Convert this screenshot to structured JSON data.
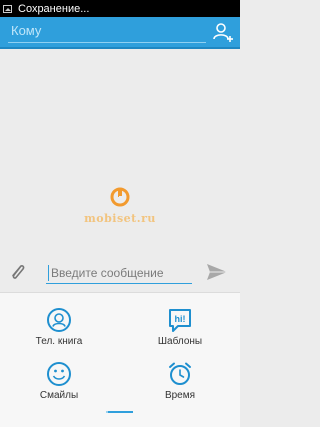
{
  "status_bar": {
    "text": "Сохранение..."
  },
  "header": {
    "to_placeholder": "Кому"
  },
  "watermark": {
    "text": "mobiset.ru"
  },
  "composer": {
    "placeholder": "Введите сообщение"
  },
  "tools": [
    {
      "label": "Тел. книга",
      "icon": "contacts-book-icon"
    },
    {
      "label": "Шаблоны",
      "icon": "templates-icon"
    },
    {
      "label": "Смайлы",
      "icon": "smiley-icon"
    },
    {
      "label": "Время",
      "icon": "alarm-clock-icon"
    }
  ],
  "colors": {
    "accent": "#2f9fdc",
    "background": "#ececec",
    "panel": "#f7f7f7"
  }
}
